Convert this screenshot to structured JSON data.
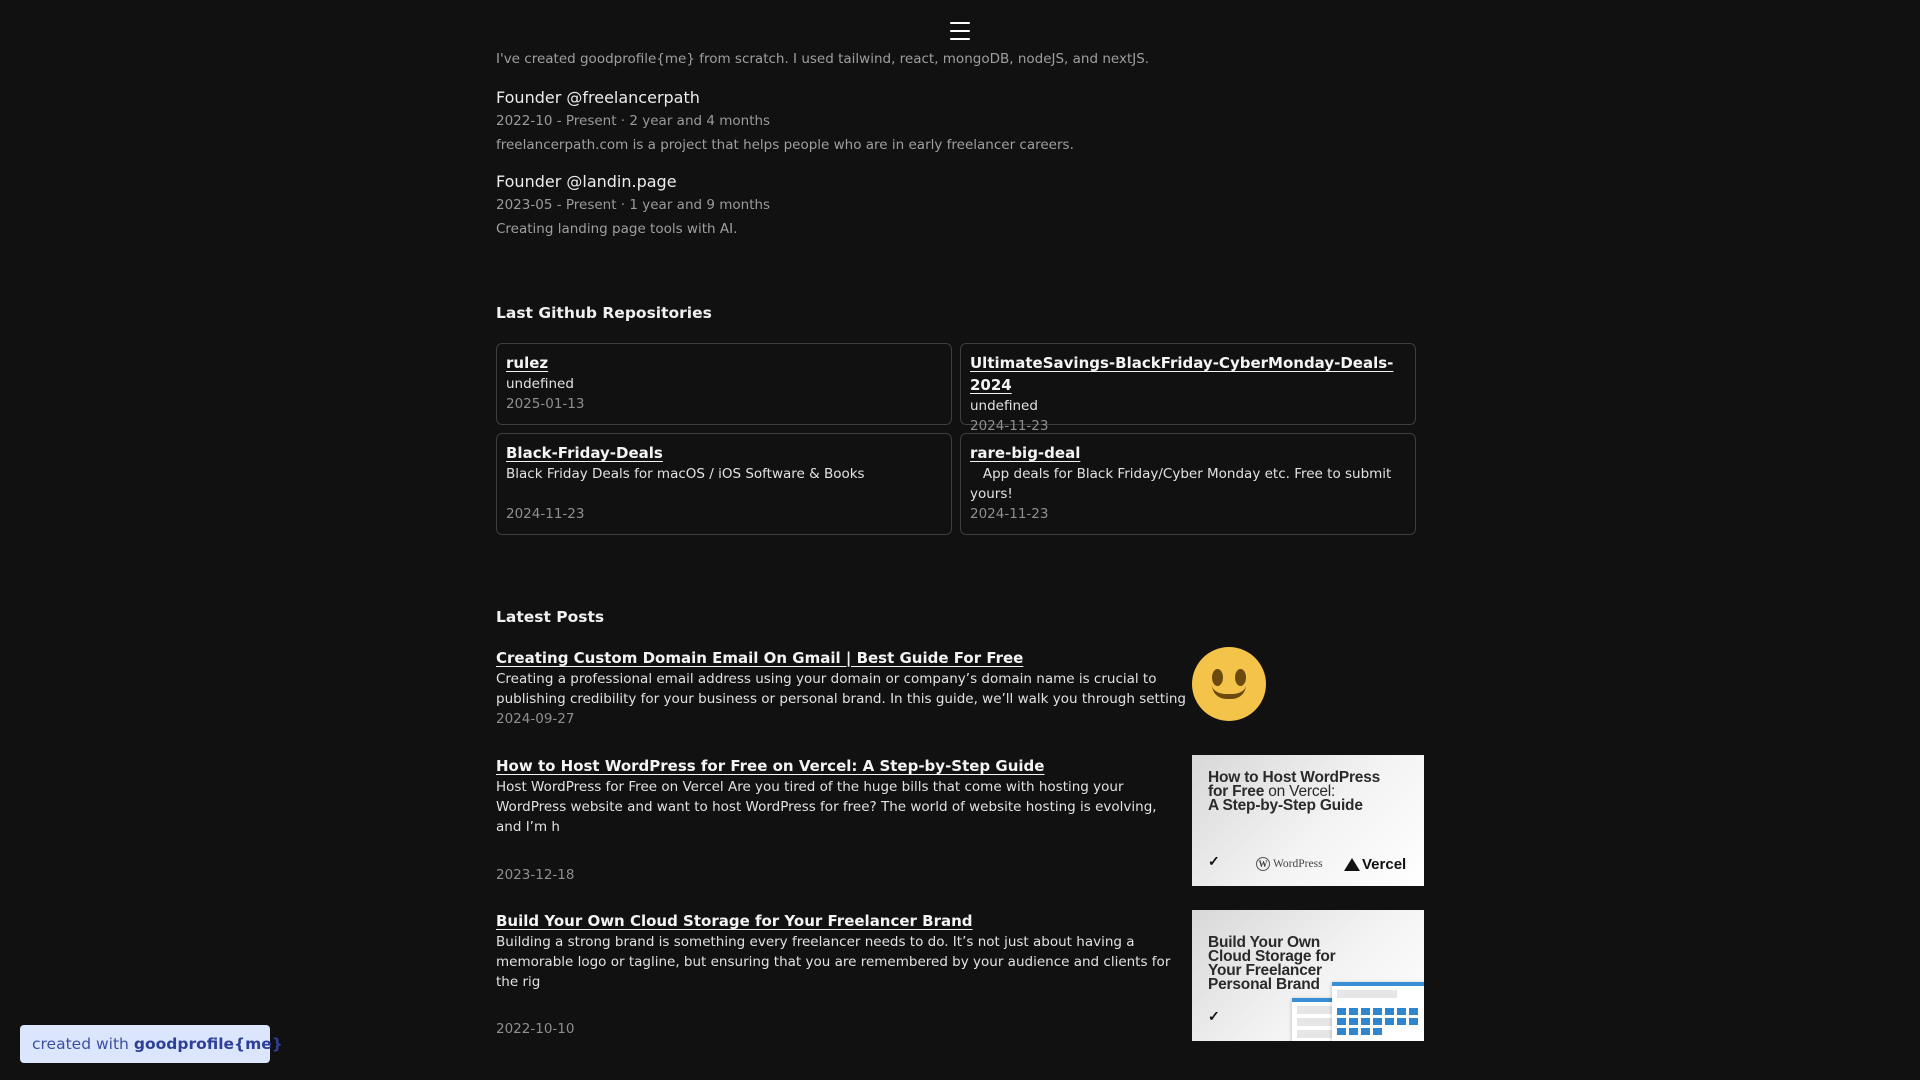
{
  "header": {
    "menu_icon": "hamburger-menu-icon"
  },
  "intro": {
    "text": "I've created goodprofile{me} from scratch. I used tailwind, react, mongoDB, nodeJS, and nextJS."
  },
  "experience": [
    {
      "title": "Founder @freelancerpath",
      "period": "2022-10 - Present · 2 year and 4 months",
      "description": "freelancerpath.com is a project that helps people who are in early freelancer careers."
    },
    {
      "title": "Founder @landin.page",
      "period": "2023-05 - Present · 1 year and 9 months",
      "description": "Creating landing page tools with AI."
    }
  ],
  "repos_section": {
    "title": "Last Github Repositories",
    "items": [
      {
        "name": "rulez",
        "description": "undefined",
        "date": "2025-01-13"
      },
      {
        "name": "UltimateSavings-BlackFriday-CyberMonday-Deals-2024",
        "description": "undefined",
        "date": "2024-11-23"
      },
      {
        "name": "Black-Friday-Deals",
        "description": "Black Friday Deals for macOS / iOS Software & Books",
        "date": "2024-11-23"
      },
      {
        "name": "rare-big-deal",
        "description": "   App deals for Black Friday/Cyber Monday etc. Free to submit yours!",
        "date": "2024-11-23"
      }
    ]
  },
  "posts_section": {
    "title": "Latest Posts",
    "items": [
      {
        "title": "Creating Custom Domain Email On Gmail | Best Guide For Free",
        "excerpt": "Creating a professional email address using your domain or company’s domain name is crucial to publishing credibility for your business or personal brand. In this guide, we’ll walk you through setting",
        "date": "2024-09-27",
        "thumbnail": "smiling-face-emoji"
      },
      {
        "title": "How to Host WordPress for Free on Vercel: A Step-by-Step Guide",
        "excerpt": "Host WordPress for Free on Vercel Are you tired of the huge bills that come with hosting your WordPress website and want to host WordPress for free? The world of website hosting is evolving, and I’m h",
        "date": "2023-12-18",
        "thumbnail": "wordpress-vercel-cover",
        "thumb_text": {
          "line1": "How to Host WordPress",
          "line2_bold": "for Free",
          "line2_rest": " on Vercel:",
          "line3": "A Step-by-Step Guide",
          "mark": "✓",
          "wordpress": "WordPress",
          "wordpress_logo": "W",
          "vercel": "Vercel"
        }
      },
      {
        "title": "Build Your Own Cloud Storage for Your Freelancer Brand",
        "excerpt": "Building a strong brand is something every freelancer needs to do. It’s not just about having a memorable logo or tagline, but ensuring that you are remembered by your audience and clients for the rig",
        "date": "2022-10-10",
        "thumbnail": "cloud-storage-cover",
        "thumb_text": {
          "line1": "Build Your Own",
          "line2": "Cloud Storage for",
          "line3": "Your Freelancer",
          "line4": "Personal Brand",
          "mark": "✓"
        }
      }
    ]
  },
  "footer_badge": {
    "prefix": "created with",
    "brand": "goodprofile{me}",
    "bg": "#dbe6fd",
    "fg": "#3b4fa5"
  }
}
